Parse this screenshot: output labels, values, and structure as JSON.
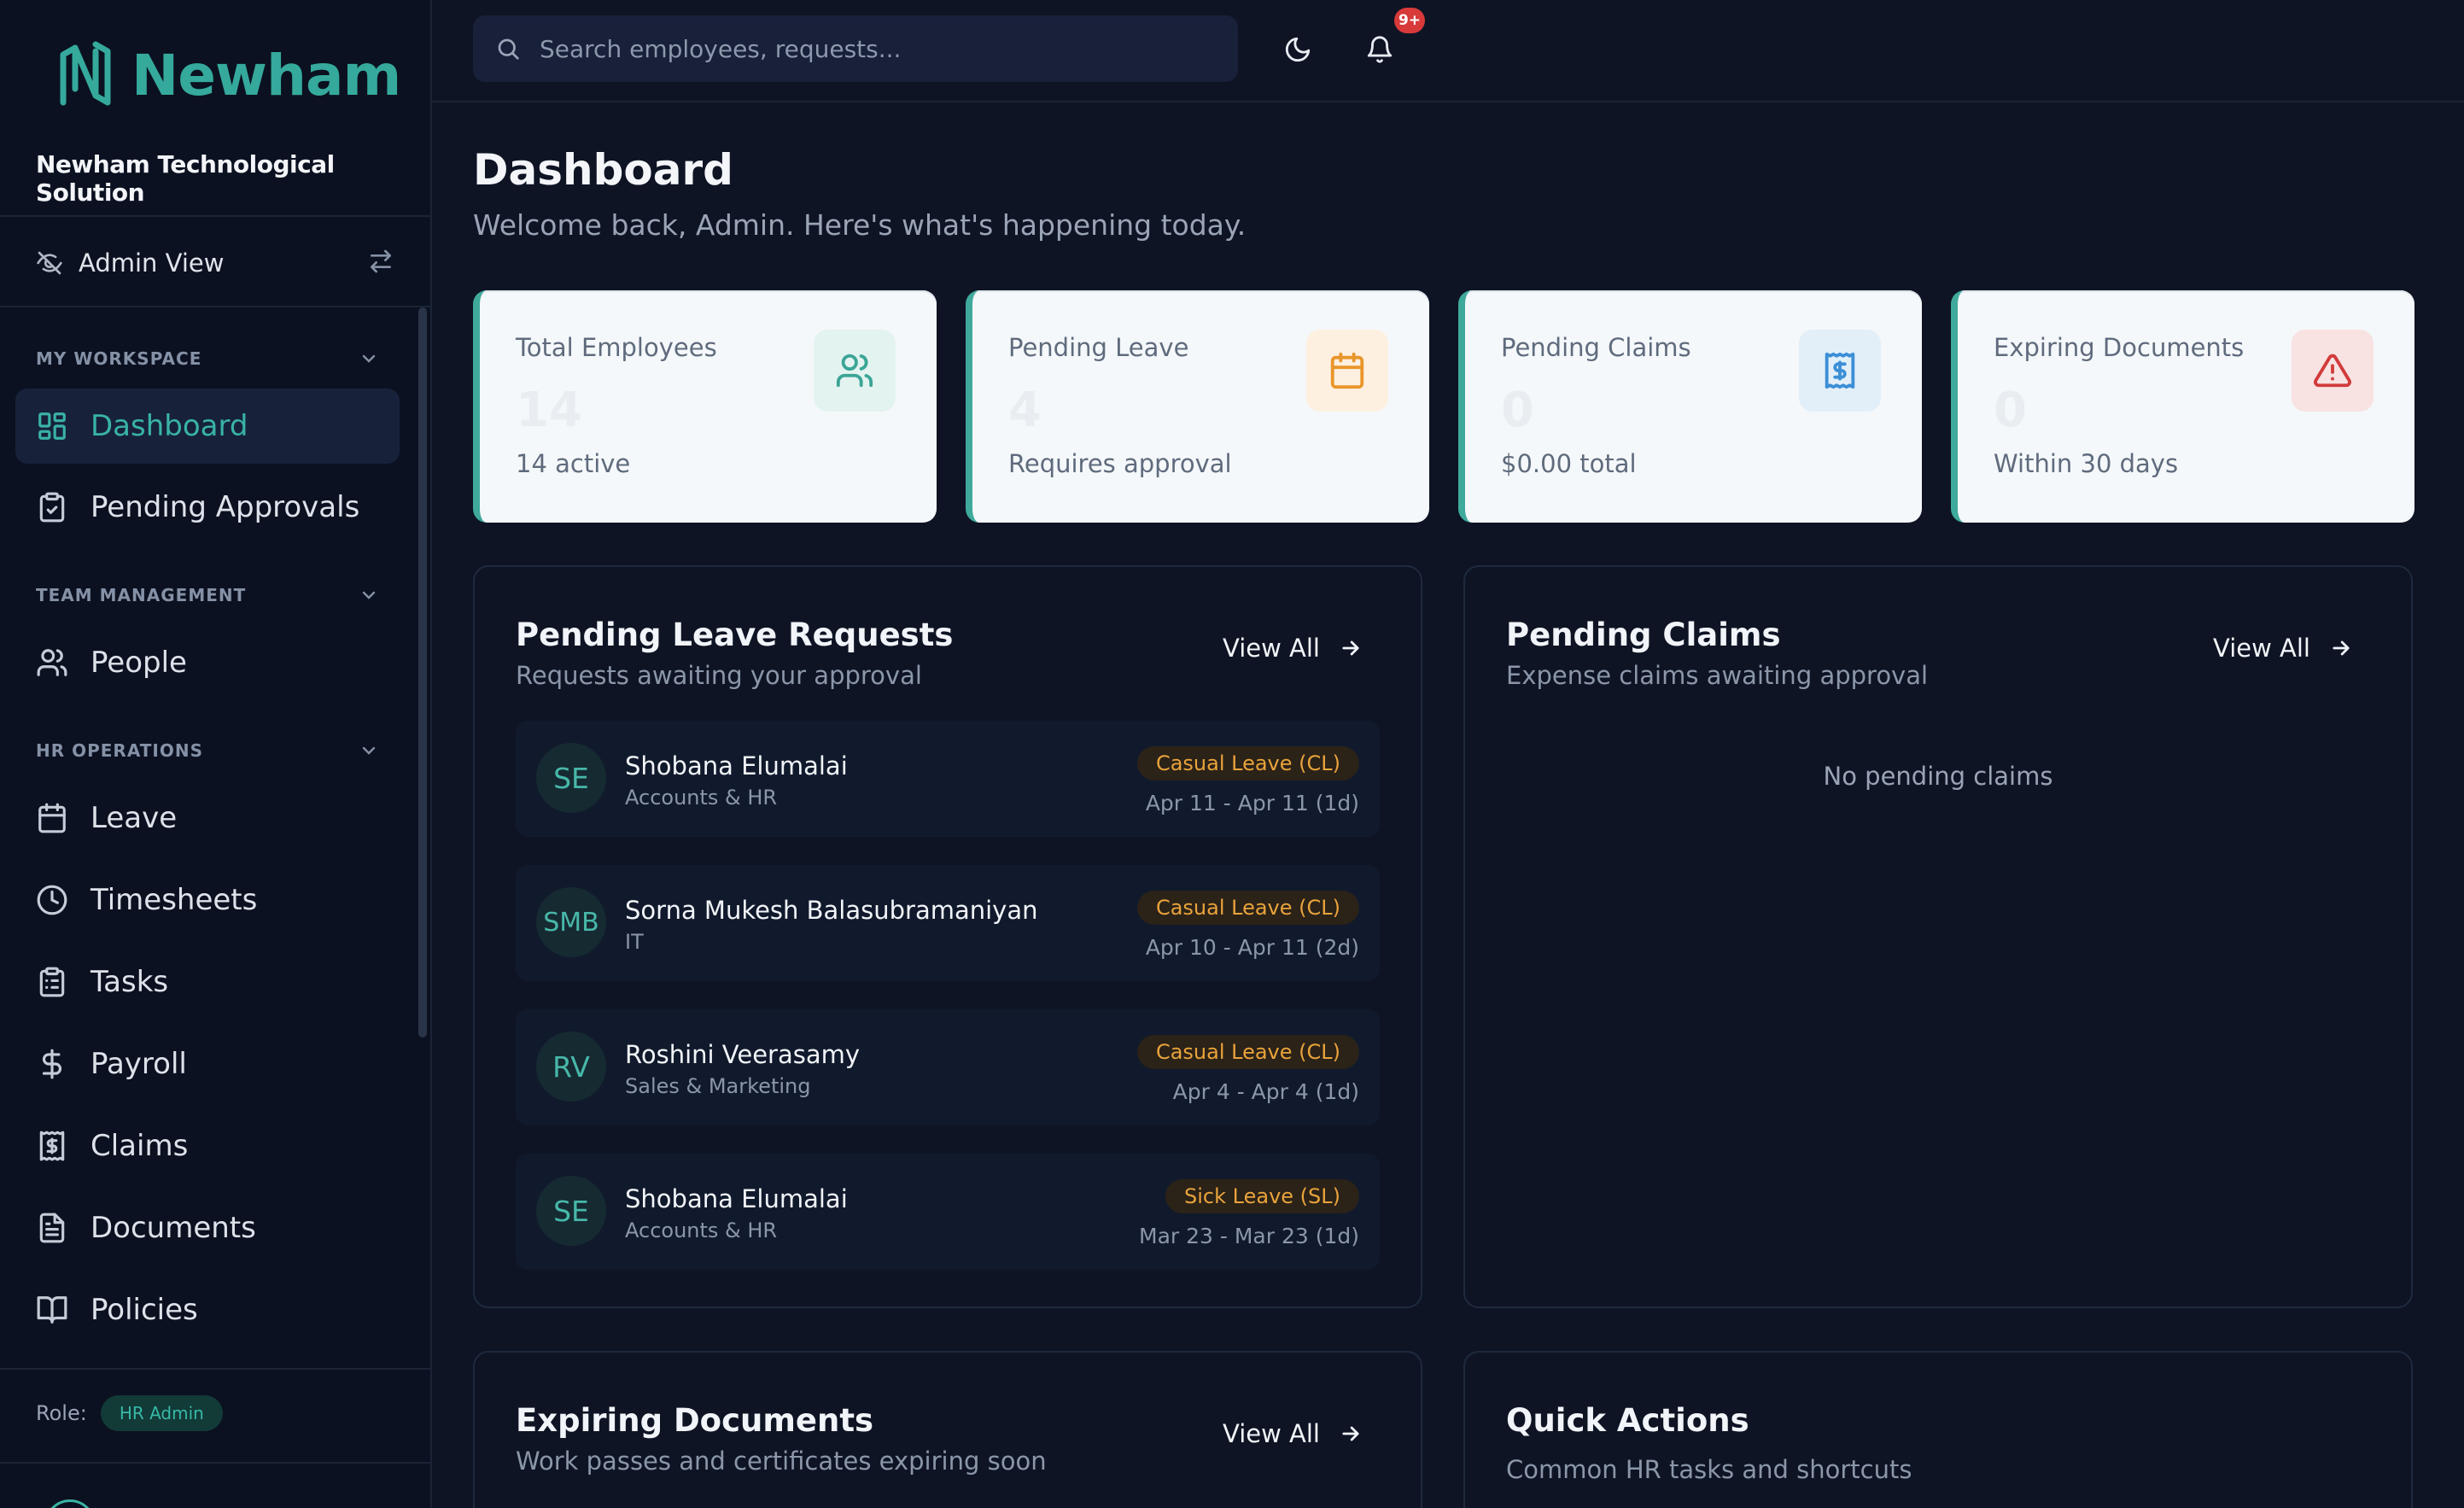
{
  "brand": {
    "name": "Newham",
    "company": "Newham Technological Solution"
  },
  "view_toggle": {
    "label": "Admin View"
  },
  "sidebar": {
    "sections": [
      {
        "title": "MY WORKSPACE",
        "items": [
          {
            "label": "Dashboard",
            "active": true
          },
          {
            "label": "Pending Approvals"
          }
        ]
      },
      {
        "title": "TEAM MANAGEMENT",
        "items": [
          {
            "label": "People"
          }
        ]
      },
      {
        "title": "HR OPERATIONS",
        "items": [
          {
            "label": "Leave"
          },
          {
            "label": "Timesheets"
          },
          {
            "label": "Tasks"
          },
          {
            "label": "Payroll"
          },
          {
            "label": "Claims"
          },
          {
            "label": "Documents"
          },
          {
            "label": "Policies"
          }
        ]
      }
    ],
    "role_label": "Role:",
    "role_value": "HR Admin"
  },
  "search": {
    "placeholder": "Search employees, requests..."
  },
  "notifications": {
    "badge": "9+"
  },
  "page": {
    "title": "Dashboard",
    "subtitle": "Welcome back, Admin. Here's what's happening today."
  },
  "stats": [
    {
      "title": "Total Employees",
      "value": "14",
      "sub": "14 active",
      "icon": "users-icon",
      "icon_color": "#3aa596",
      "icon_bg": "#e3f3f0"
    },
    {
      "title": "Pending Leave",
      "value": "4",
      "sub": "Requires approval",
      "icon": "calendar-icon",
      "icon_color": "#e9962b",
      "icon_bg": "#fdf0e0"
    },
    {
      "title": "Pending Claims",
      "value": "0",
      "sub": "$0.00 total",
      "icon": "receipt-icon",
      "icon_color": "#3c8fd6",
      "icon_bg": "#e2eff9"
    },
    {
      "title": "Expiring Documents",
      "value": "0",
      "sub": "Within 30 days",
      "icon": "alert-triangle-icon",
      "icon_color": "#d23b3b",
      "icon_bg": "#f8e2e2"
    }
  ],
  "leave_card": {
    "title": "Pending Leave Requests",
    "subtitle": "Requests awaiting your approval",
    "view_all": "View All",
    "requests": [
      {
        "initials": "SE",
        "name": "Shobana Elumalai",
        "dept": "Accounts & HR",
        "type": "Casual Leave (CL)",
        "dates": "Apr 11 - Apr 11 (1d)"
      },
      {
        "initials": "SMB",
        "name": "Sorna Mukesh Balasubramaniyan",
        "dept": "IT",
        "type": "Casual Leave (CL)",
        "dates": "Apr 10 - Apr 11 (2d)"
      },
      {
        "initials": "RV",
        "name": "Roshini Veerasamy",
        "dept": "Sales & Marketing",
        "type": "Casual Leave (CL)",
        "dates": "Apr 4 - Apr 4 (1d)"
      },
      {
        "initials": "SE",
        "name": "Shobana Elumalai",
        "dept": "Accounts & HR",
        "type": "Sick Leave (SL)",
        "dates": "Mar 23 - Mar 23 (1d)"
      }
    ]
  },
  "claims_card": {
    "title": "Pending Claims",
    "subtitle": "Expense claims awaiting approval",
    "view_all": "View All",
    "empty": "No pending claims"
  },
  "docs_card": {
    "title": "Expiring Documents",
    "subtitle": "Work passes and certificates expiring soon",
    "view_all": "View All"
  },
  "quick_card": {
    "title": "Quick Actions",
    "subtitle": "Common HR tasks and shortcuts"
  }
}
